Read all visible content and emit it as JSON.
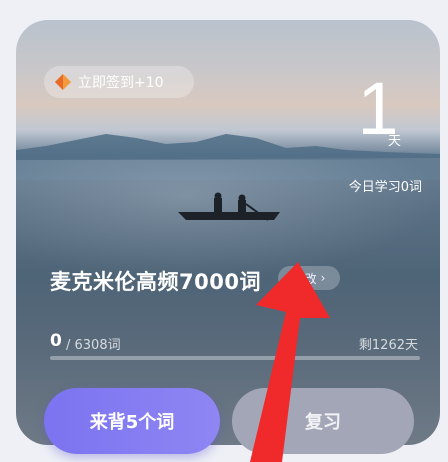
{
  "checkin": {
    "label": "立即签到+10",
    "icon": "diamond-icon"
  },
  "streak": {
    "days": "1",
    "unit": "天"
  },
  "today": {
    "label": "今日学习0词"
  },
  "book": {
    "title": "麦克米伦高频7000词",
    "edit_label": "修改"
  },
  "progress": {
    "learned": "0",
    "total": "/ 6308词",
    "remaining": "剩1262天",
    "fraction": 0
  },
  "actions": {
    "study_label": "来背5个词",
    "review_label": "复习"
  },
  "colors": {
    "primary": "#7b73f0",
    "secondary": "#a3a6b7",
    "annotation_arrow": "#f02a2a"
  }
}
